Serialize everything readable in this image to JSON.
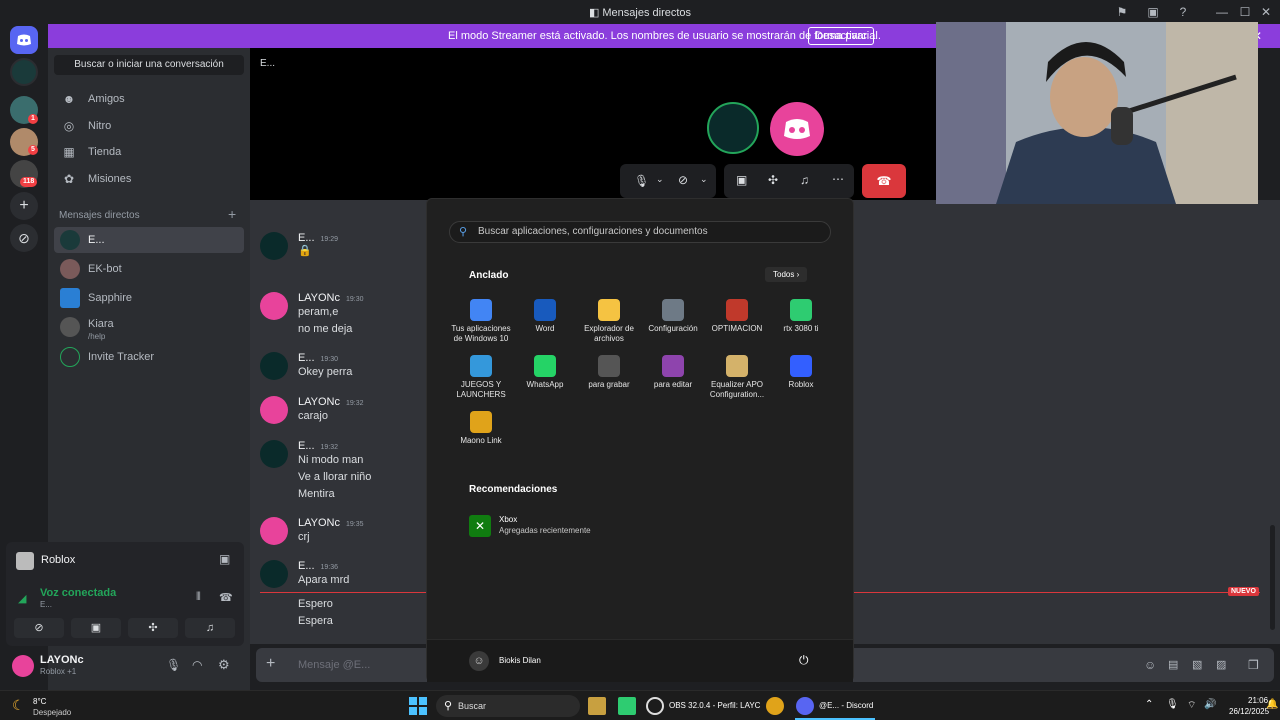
{
  "window": {
    "title": "Mensajes directos"
  },
  "banner": {
    "text": "El modo Streamer está activado. Los nombres de usuario se mostrarán de forma parcial.",
    "button": "Desactivar"
  },
  "rail": {
    "badges": [
      "1",
      "5",
      "118"
    ]
  },
  "sidebar": {
    "search": "Buscar o iniciar una conversación",
    "nav": [
      {
        "label": "Amigos",
        "icon": "friends-icon"
      },
      {
        "label": "Nitro",
        "icon": "nitro-icon"
      },
      {
        "label": "Tienda",
        "icon": "shop-icon"
      },
      {
        "label": "Misiones",
        "icon": "quests-icon"
      }
    ],
    "dm_header": "Mensajes directos",
    "dms": [
      {
        "name": "E...",
        "sub": ""
      },
      {
        "name": "EK-bot",
        "sub": ""
      },
      {
        "name": "Sapphire",
        "sub": ""
      },
      {
        "name": "Kiara",
        "sub": "/help"
      },
      {
        "name": "Invite Tracker",
        "sub": ""
      }
    ]
  },
  "voice_panel": {
    "activity": "Roblox",
    "status": "Voz conectada",
    "channel": "E..."
  },
  "user": {
    "name": "LAYONc",
    "activity": "Roblox +1"
  },
  "call": {
    "channel_label": "E..."
  },
  "messages": [
    {
      "name": "E...",
      "time": "19:29",
      "lines": [
        "🔒"
      ],
      "type": "dm"
    },
    {
      "name": "LAYONc",
      "time": "19:30",
      "lines": [
        "peram,e",
        "no me deja"
      ],
      "type": "me"
    },
    {
      "name": "E...",
      "time": "19:30",
      "lines": [
        "Okey perra"
      ],
      "type": "dm"
    },
    {
      "name": "LAYONc",
      "time": "19:32",
      "lines": [
        "carajo"
      ],
      "type": "me"
    },
    {
      "name": "E...",
      "time": "19:32",
      "lines": [
        "Ni modo man",
        "Ve a llorar niño",
        "Mentira"
      ],
      "type": "dm"
    },
    {
      "name": "LAYONc",
      "time": "19:35",
      "lines": [
        "crj"
      ],
      "type": "me"
    },
    {
      "name": "E...",
      "time": "19:36",
      "lines": [
        "Apara mrd",
        "Espero",
        "Espera"
      ],
      "type": "dm"
    }
  ],
  "new_label": "NUEVO",
  "composer": {
    "placeholder": "Mensaje @E..."
  },
  "start_menu": {
    "search_placeholder": "Buscar aplicaciones, configuraciones y documentos",
    "pinned_title": "Anclado",
    "all_button": "Todos",
    "apps": [
      {
        "label": "Tus aplicaciones de Windows 10",
        "color": "#4285f4"
      },
      {
        "label": "Word",
        "color": "#185abd"
      },
      {
        "label": "Explorador de archivos",
        "color": "#f5c342"
      },
      {
        "label": "Configuración",
        "color": "#6e7a86"
      },
      {
        "label": "OPTIMACION",
        "color": "#c0392b"
      },
      {
        "label": "rtx 3080 ti",
        "color": "#2ecc71"
      },
      {
        "label": "JUEGOS Y LAUNCHERS",
        "color": "#3498db"
      },
      {
        "label": "WhatsApp",
        "color": "#25d366"
      },
      {
        "label": "para grabar",
        "color": "#555555"
      },
      {
        "label": "para editar",
        "color": "#8e44ad"
      },
      {
        "label": "Equalizer APO Configuration...",
        "color": "#d4b26a"
      },
      {
        "label": "Roblox",
        "color": "#335fff"
      },
      {
        "label": "Maono Link",
        "color": "#e0a31a"
      }
    ],
    "recommended_title": "Recomendaciones",
    "recommended": [
      {
        "title": "Xbox",
        "sub": "Agregadas recientemente"
      }
    ],
    "user": "Biokis Dilan"
  },
  "taskbar": {
    "weather_temp": "8°C",
    "weather_desc": "Despejado",
    "search": "Buscar",
    "obs": "OBS 32.0.4 - Perfil: LAYC",
    "discord": "@E... - Discord",
    "time": "21:06",
    "date": "26/12/2025"
  },
  "colors": {
    "discord_blurple": "#5865f2",
    "banner": "#8b3ddc",
    "red": "#da373c",
    "avatar_pink": "#e8439b"
  }
}
